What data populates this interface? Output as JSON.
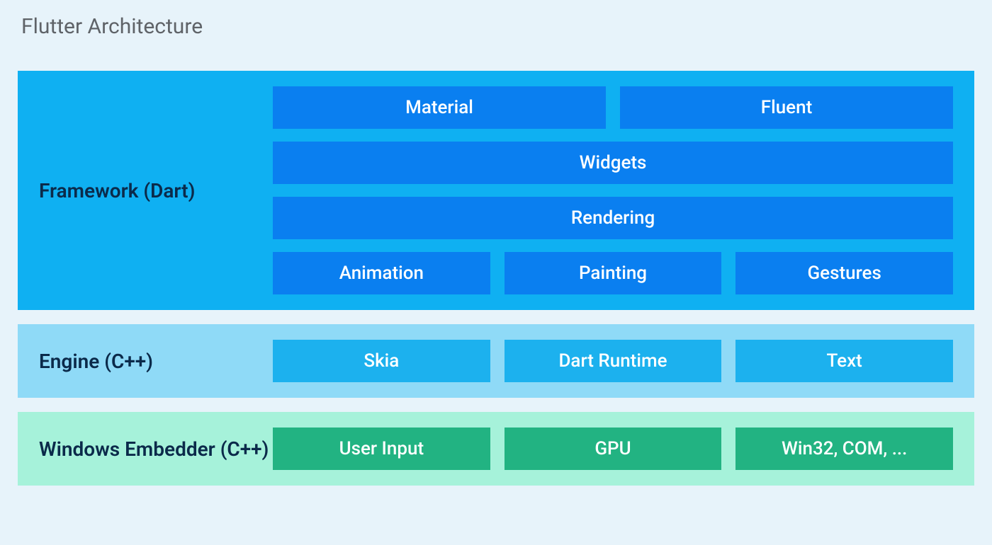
{
  "title": "Flutter Architecture",
  "layers": {
    "framework": {
      "label": "Framework (Dart)",
      "rows": {
        "top": {
          "material": "Material",
          "fluent": "Fluent"
        },
        "widgets": "Widgets",
        "rendering": "Rendering",
        "bottom": {
          "animation": "Animation",
          "painting": "Painting",
          "gestures": "Gestures"
        }
      }
    },
    "engine": {
      "label": "Engine (C++)",
      "row": {
        "skia": "Skia",
        "dart": "Dart Runtime",
        "text": "Text"
      }
    },
    "embedder": {
      "label": "Windows Embedder (C++)",
      "row": {
        "input": "User Input",
        "gpu": "GPU",
        "win32": "Win32, COM, ..."
      }
    }
  }
}
